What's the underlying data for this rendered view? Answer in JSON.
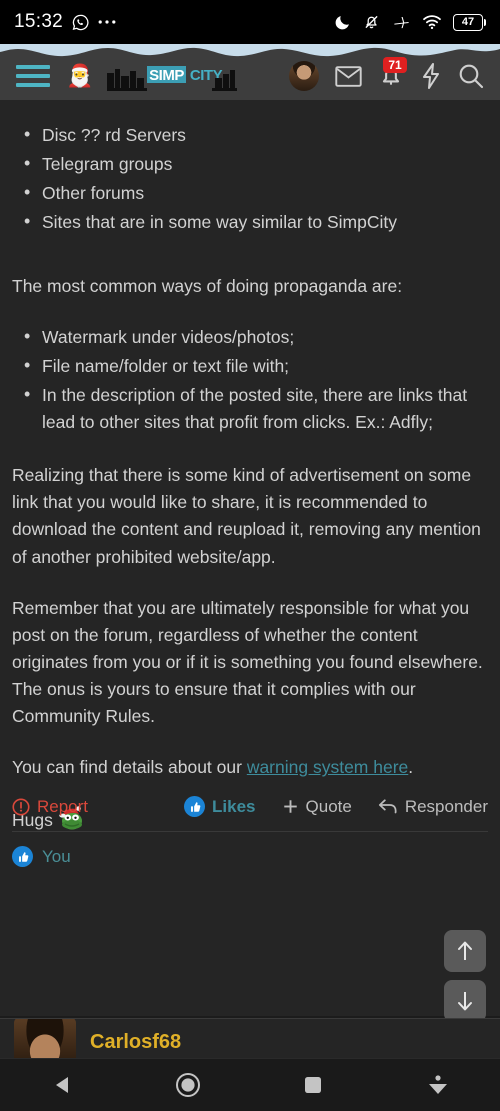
{
  "status_bar": {
    "time": "15:32",
    "left_icons": [
      "whatsapp-icon",
      "more-dots-icon"
    ],
    "right_icons": [
      "moon-dnd-icon",
      "bell-muted-icon",
      "airplane-mode-icon",
      "wifi-icon"
    ],
    "battery_percent": "47"
  },
  "header": {
    "menu_label": "menu",
    "santa_icon": "🎅",
    "logo_text_1": "SIMP",
    "logo_text_2": "CITY",
    "avatar_alt": "user-avatar",
    "inbox_icon": "envelope-icon",
    "alerts_badge": "71",
    "bolt_icon": "lightning-bolt-icon",
    "search_icon": "search-icon",
    "accent_color": "#4eb5c4"
  },
  "post": {
    "list_1": [
      "Disc ?? rd Servers",
      "Telegram groups",
      "Other forums",
      "Sites that are in some way similar to SimpCity"
    ],
    "para_1": "The most common ways of doing propaganda are:",
    "list_2": [
      "Watermark under videos/photos;",
      "File name/folder or text file with;",
      "In the description of the posted site, there are links that lead to other sites that profit from clicks. Ex.: Adfly;"
    ],
    "para_2": "Realizing that there is some kind of advertisement on some link that you would like to share, it is recommended to download the content and reupload it, removing any mention of another prohibited website/app.",
    "para_3": "Remember that you are ultimately responsible for what you post on the forum, regardless of whether the content originates from you or if it is something you found elsewhere. The onus is yours to ensure that it complies with our Community Rules.",
    "para_4_prefix": "You can find details about our ",
    "para_4_link": "warning system here",
    "para_4_suffix": ".",
    "signoff": "Hugs",
    "signoff_emoji": "pepe-santa-emoji",
    "link_color": "#3e8c9c"
  },
  "actions": {
    "report_label": "Report",
    "report_icon": "exclamation-circle-icon",
    "report_color": "#d9483b",
    "likes_label": "Likes",
    "likes_icon": "thumbs-up-icon",
    "likes_color": "#3e8c9c",
    "quote_label": "Quote",
    "quote_icon": "plus-icon",
    "reply_label": "Responder",
    "reply_icon": "reply-arrow-icon"
  },
  "likes_row": {
    "icon": "thumbs-up-icon",
    "label": "You"
  },
  "scroll_buttons": {
    "up_icon": "arrow-up-icon",
    "up_label": "Scroll to top",
    "down_icon": "arrow-down-icon",
    "down_label": "Scroll to bottom"
  },
  "next_post": {
    "username": "Carlosf68",
    "username_color": "#e0b028",
    "avatar_alt": "carlosf68-avatar"
  },
  "navbar": {
    "back_icon": "back-triangle-icon",
    "home_icon": "home-circle-icon",
    "recents_icon": "recents-square-icon",
    "hide_icon": "hide-keyboard-icon"
  }
}
